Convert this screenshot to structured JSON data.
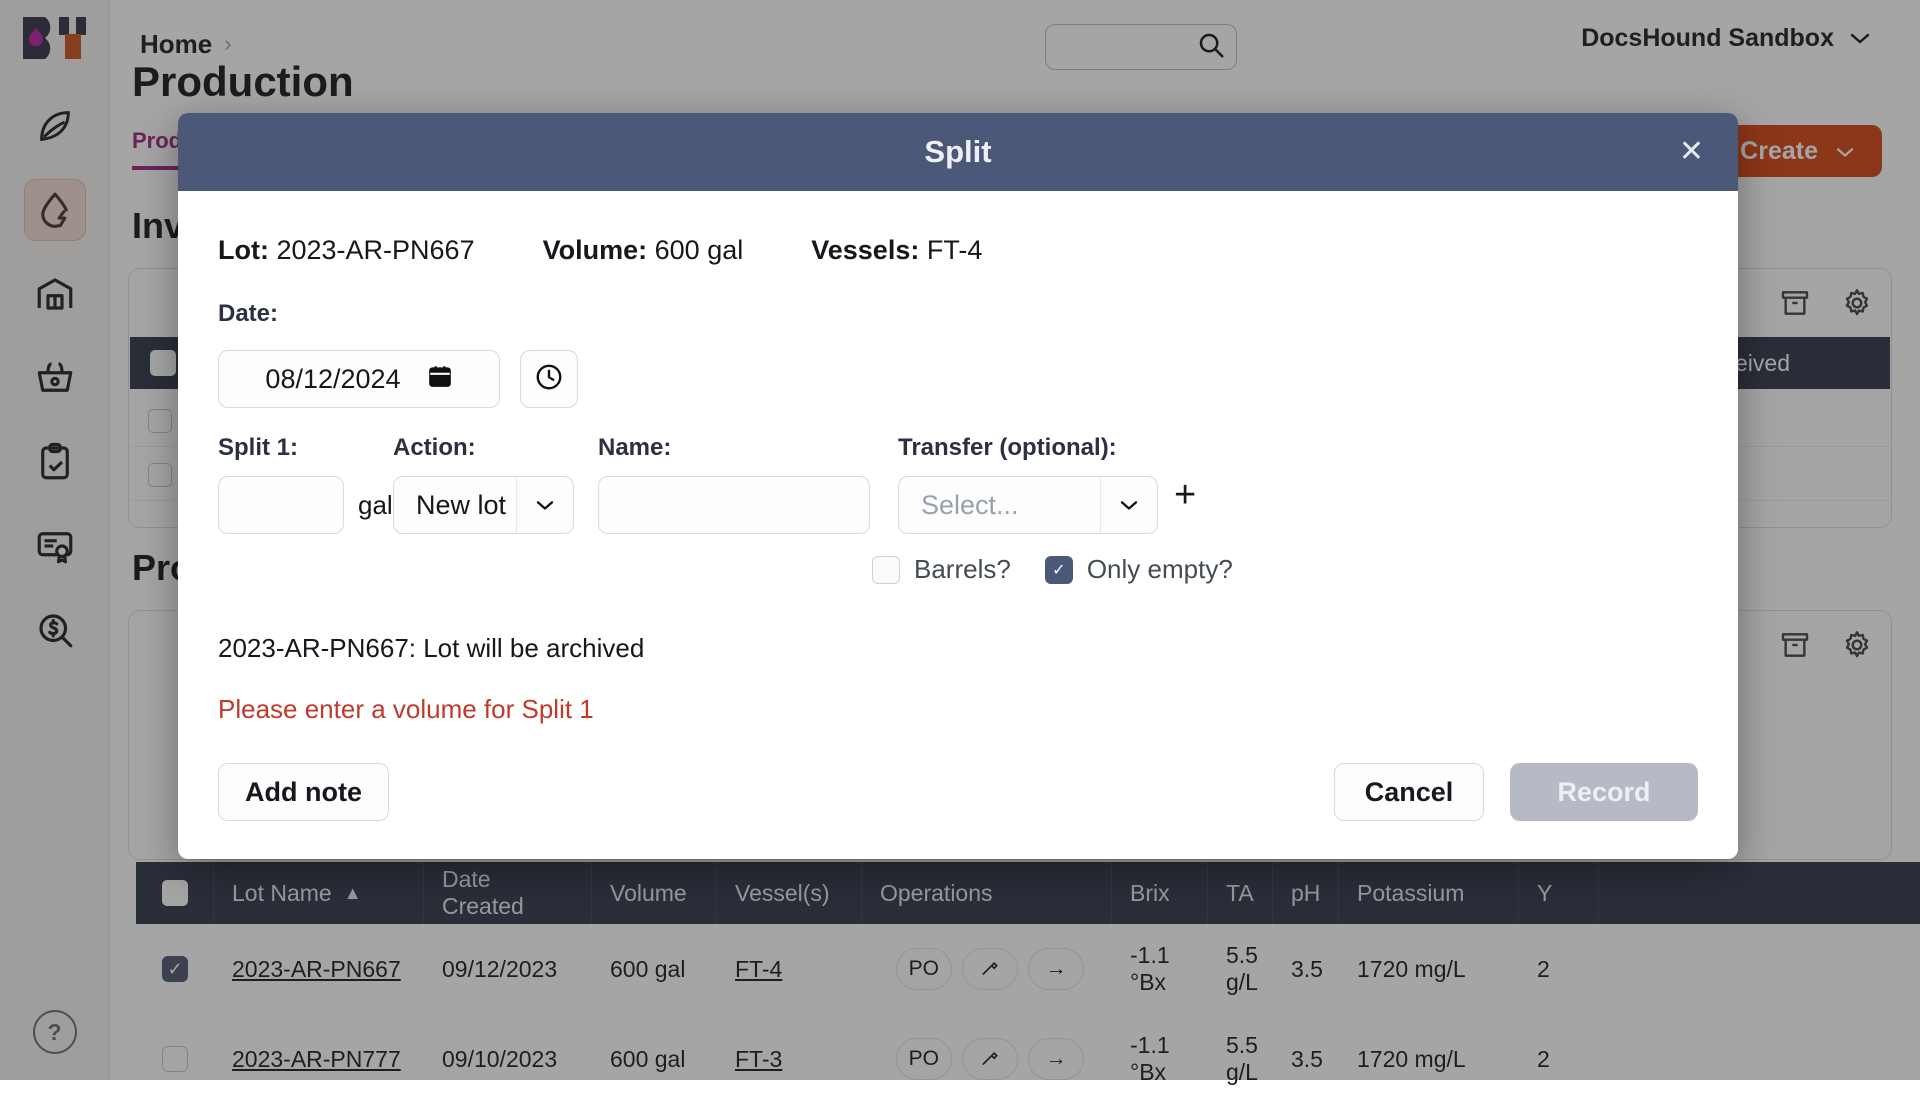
{
  "app": {
    "sidebar": {
      "logo_name": "bottlebooks-logo",
      "items": [
        {
          "name": "sidebar-item-vineyard",
          "icon": "leaf-icon",
          "active": false
        },
        {
          "name": "sidebar-item-production",
          "icon": "water-drop-lightning-icon",
          "active": true
        },
        {
          "name": "sidebar-item-warehouse",
          "icon": "warehouse-icon",
          "active": false
        },
        {
          "name": "sidebar-item-sales",
          "icon": "basket-icon",
          "active": false
        },
        {
          "name": "sidebar-item-tasks",
          "icon": "clipboard-check-icon",
          "active": false
        },
        {
          "name": "sidebar-item-compliance",
          "icon": "certificate-icon",
          "active": false
        },
        {
          "name": "sidebar-item-costing",
          "icon": "dollar-search-icon",
          "active": false
        }
      ],
      "help_label": "?"
    },
    "header": {
      "breadcrumb": "Home",
      "breadcrumb_chevron": "›",
      "search_placeholder": "",
      "search_icon": "search-icon",
      "org_name": "DocsHound Sandbox",
      "org_chevron": "⌄"
    },
    "page": {
      "title": "Production",
      "tabs": [
        {
          "label": "Production",
          "active": true
        }
      ],
      "create_label": "Create",
      "create_chevron": "⌄",
      "section_inventory": "Inventory",
      "section_production": "Production",
      "status_label": "Received",
      "panel_icons": [
        "archive-icon",
        "gear-icon"
      ]
    },
    "table": {
      "columns": [
        "Lot Name",
        "Date Created",
        "Volume",
        "Vessel(s)",
        "Operations",
        "Brix",
        "TA",
        "pH",
        "Potassium",
        "Y"
      ],
      "sort_column": "Lot Name",
      "sort_arrow": "▲",
      "rows": [
        {
          "selected": true,
          "lot_name": "2023-AR-PN667",
          "date_created": "09/12/2023",
          "volume": "600 gal",
          "vessels": "FT-4",
          "operations": [
            "PO",
            "bottle-icon",
            "→"
          ],
          "brix": "-1.1 °Bx",
          "ta": "5.5 g/L",
          "ph": "3.5",
          "potassium": "1720 mg/L",
          "extra": "2"
        },
        {
          "selected": false,
          "lot_name": "2023-AR-PN777",
          "date_created": "09/10/2023",
          "volume": "600 gal",
          "vessels": "FT-3",
          "operations": [
            "PO",
            "bottle-icon",
            "→"
          ],
          "brix": "-1.1 °Bx",
          "ta": "5.5 g/L",
          "ph": "3.5",
          "potassium": "1720 mg/L",
          "extra": "2"
        }
      ]
    }
  },
  "modal": {
    "title": "Split",
    "close_glyph": "✕",
    "summary": {
      "lot_label": "Lot:",
      "lot_value": "2023-AR-PN667",
      "volume_label": "Volume:",
      "volume_value": "600 gal",
      "vessels_label": "Vessels:",
      "vessels_value": "FT-4"
    },
    "date": {
      "label": "Date:",
      "value": "08/12/2024",
      "calendar_icon": "calendar-icon",
      "clock_icon": "clock-icon"
    },
    "split_row": {
      "split_label": "Split 1:",
      "action_label": "Action:",
      "name_label": "Name:",
      "transfer_label": "Transfer (optional):",
      "volume_value": "",
      "volume_placeholder": "",
      "unit": "gal",
      "action_value": "New lot",
      "name_value": "",
      "name_placeholder": "",
      "transfer_value": "Select...",
      "add_glyph": "+",
      "chevron": "⌄"
    },
    "checkboxes": [
      {
        "label": "Barrels?",
        "checked": false,
        "name": "barrels-checkbox"
      },
      {
        "label": "Only empty?",
        "checked": true,
        "name": "only-empty-checkbox"
      }
    ],
    "archive_message": "2023-AR-PN667: Lot will be archived",
    "error_message": "Please enter a volume for Split 1",
    "footer": {
      "add_note_label": "Add note",
      "cancel_label": "Cancel",
      "record_label": "Record"
    }
  },
  "colors": {
    "modal_header": "#4c5878",
    "accent_magenta": "#9c1f7f",
    "create_orange": "#d4410f",
    "error_red": "#c0392b",
    "table_header": "#2b3245"
  }
}
